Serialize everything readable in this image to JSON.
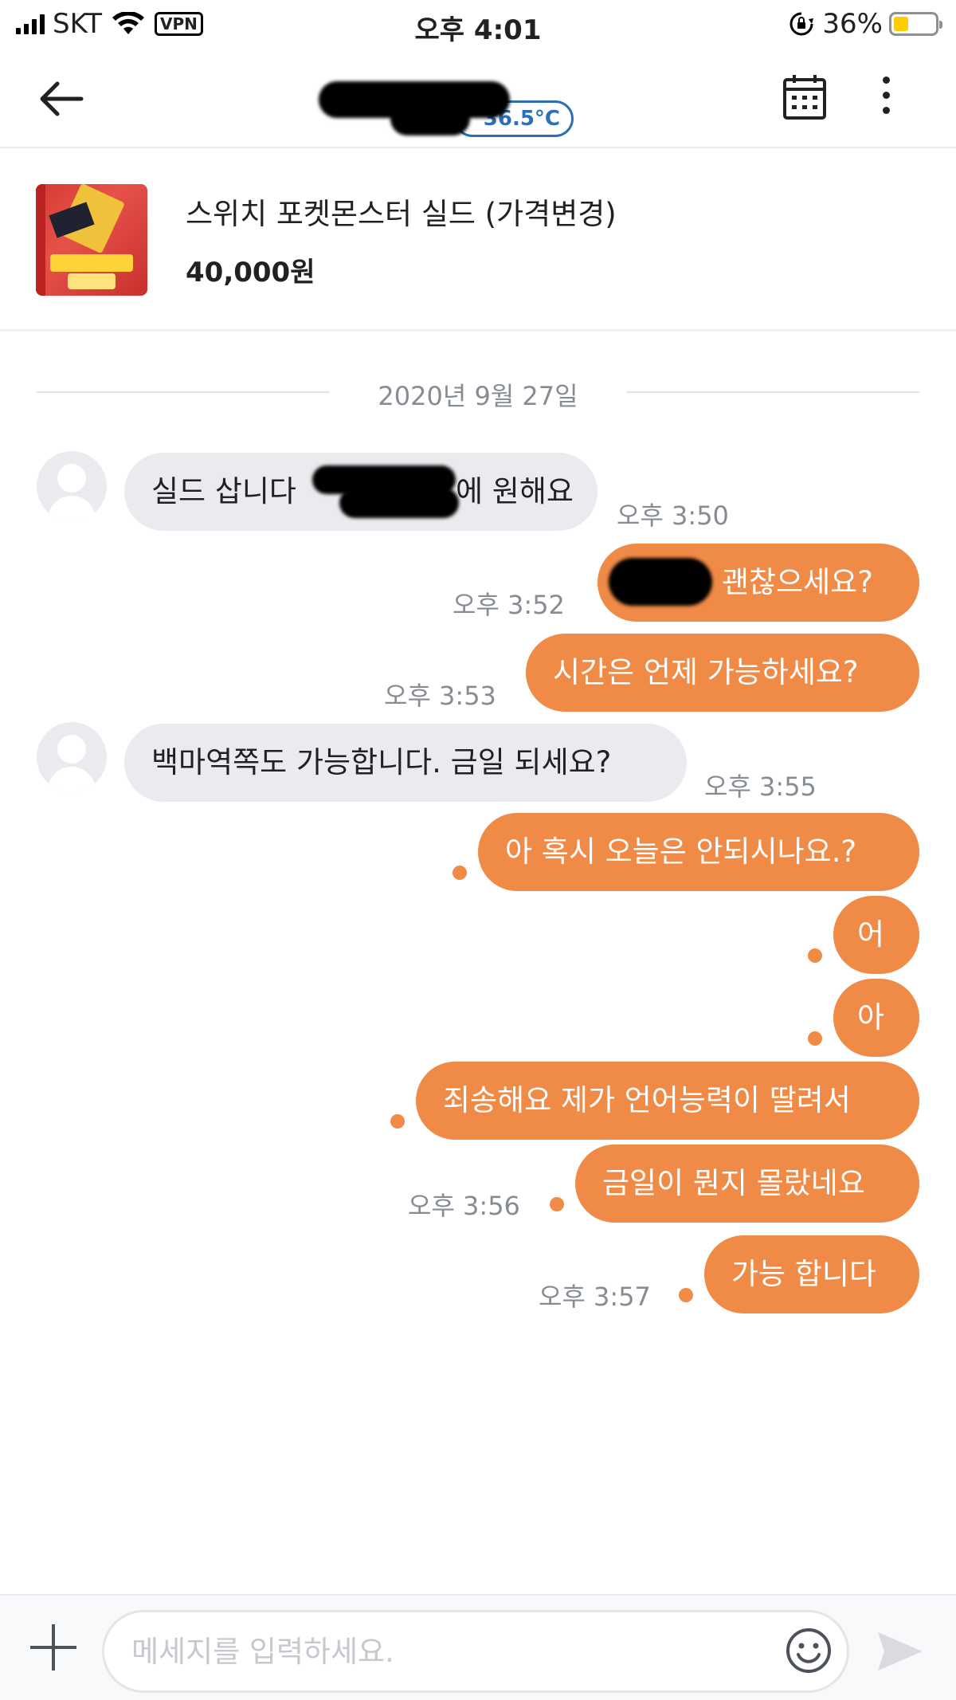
{
  "status_bar": {
    "carrier": "SKT",
    "vpn": "VPN",
    "time": "오후 4:01",
    "battery_percent": "36%",
    "battery_level": 0.36
  },
  "header": {
    "manner_temp": "36.5°C"
  },
  "product": {
    "title": "스위치 포켓몬스터 실드 (가격변경)",
    "price": "40,000원"
  },
  "date_divider": "2020년 9월 27일",
  "messages": [
    {
      "side": "in",
      "text_before": "실드 삽니다",
      "text_after": "에 원해요",
      "time": "오후 3:50"
    },
    {
      "side": "out",
      "text": "괜찮으세요?",
      "time": "오후 3:52"
    },
    {
      "side": "out",
      "text": "시간은 언제 가능하세요?",
      "time": "오후 3:53"
    },
    {
      "side": "in",
      "text": "백마역쪽도 가능합니다. 금일 되세요?",
      "time": "오후 3:55"
    },
    {
      "side": "out",
      "text": "아 혹시 오늘은 안되시나요.?"
    },
    {
      "side": "out",
      "text": "어"
    },
    {
      "side": "out",
      "text": "아"
    },
    {
      "side": "out",
      "text": "죄송해요 제가 언어능력이 딸려서"
    },
    {
      "side": "out",
      "text": "금일이 뭔지 몰랐네요",
      "time": "오후 3:56"
    },
    {
      "side": "out",
      "text": "가능 합니다",
      "time": "오후 3:57"
    }
  ],
  "input": {
    "placeholder": "메세지를 입력하세요."
  },
  "colors": {
    "accent": "#f08a47",
    "incoming_bubble": "#eaebee",
    "temp_badge": "#2a6fb8"
  },
  "icons": [
    "signal-icon",
    "wifi-icon",
    "screen-lock-icon",
    "battery-icon",
    "back-arrow-icon",
    "calendar-icon",
    "more-vertical-icon",
    "plus-icon",
    "emoji-icon",
    "send-icon",
    "avatar-icon"
  ]
}
